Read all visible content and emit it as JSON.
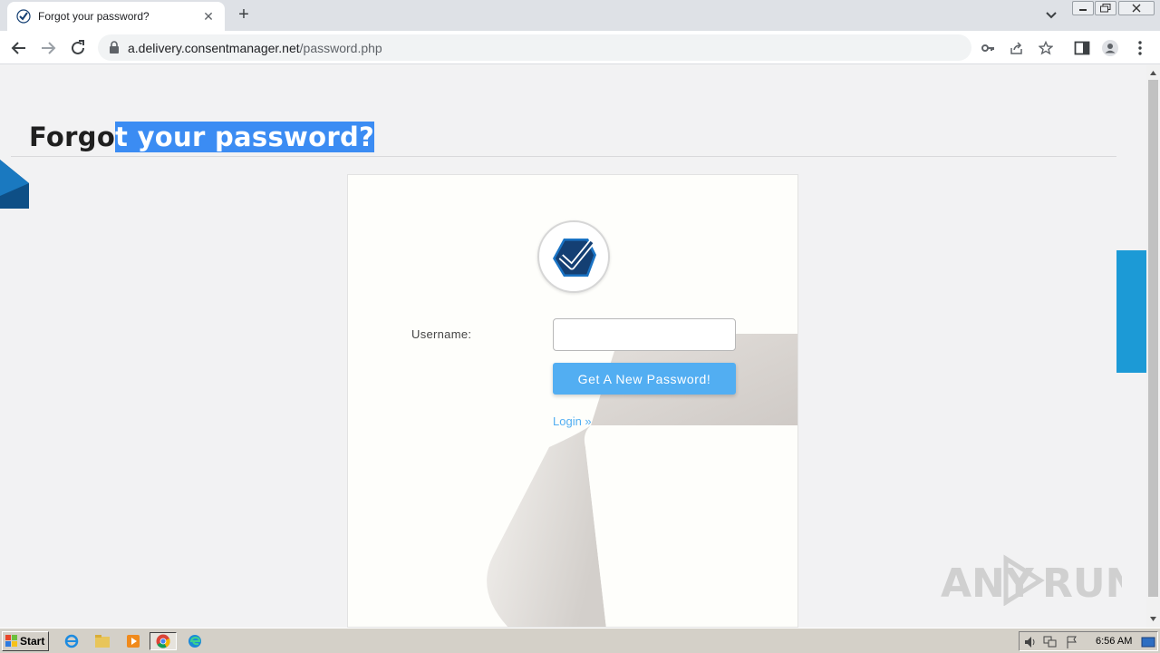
{
  "browser": {
    "tab_title": "Forgot your password?",
    "url_host": "a.delivery.consentmanager.net",
    "url_path": "/password.php",
    "new_tab_symbol": "+",
    "close_tab_symbol": "✕"
  },
  "page": {
    "heading_unselected": "Forgo",
    "heading_selected": "t your password?",
    "form": {
      "username_label": "Username:",
      "username_value": "",
      "submit_label": "Get A New Password!",
      "login_link": "Login »"
    }
  },
  "watermark": {
    "text_left": "ANY",
    "text_right": "RUN"
  },
  "taskbar": {
    "start_label": "Start",
    "clock": "6:56 AM"
  },
  "colors": {
    "accent_button": "#52aef2",
    "selection": "#3b8cf3",
    "side_tab_blue": "#1c9ad6",
    "logo_dark": "#143f73"
  }
}
